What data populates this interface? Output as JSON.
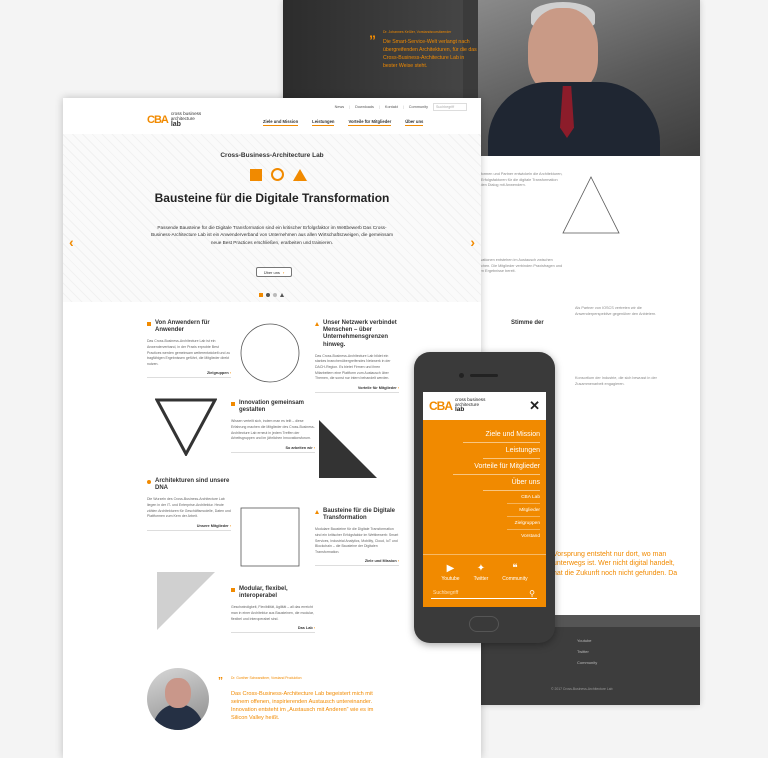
{
  "back": {
    "quote_author": "Dr. Johannes Keßler, Vorstandsvorsitzender",
    "quote_text": "Die Smart-Service-Welt verlangt nach übergreifenden Architekturen, für die das Cross-Business-Architecture Lab in bester Weise steht.",
    "body1": "Plattformen und Partner entwickeln die Architekturen, sind Erfolgsfaktoren für die digitale Transformation und den Dialog mit Anwendern.",
    "body2": "Innovationen entstehen im Austausch zwischen Branchen. Die Mitglieder verbinden Praxisfragen und stellen Ergebnisse bereit.",
    "stimme": "Stimme der",
    "body3": "Als Partner von IOSCS vertreten wir die Anwenderperspektive gegenüber den Anbietern.",
    "body4": "Konsortium der Industrie, die sich bewusst in der Zusammenarbeit engagieren.",
    "orange_text": "Vorsprung entsteht nur dort, wo man unterwegs ist. Wer nicht digital handelt, hat die Zukunft noch nicht gefunden. Da",
    "footer_social": [
      "Youtube",
      "Twitter",
      "Community"
    ],
    "copyright": "© 2017 Cross-Business-Architecture Lab"
  },
  "topbar": {
    "links": [
      "News",
      "Downloads",
      "Kontakt",
      "Community"
    ],
    "search_placeholder": "Suchbegriff"
  },
  "logo": {
    "mark": "CBA",
    "line1": "cross business",
    "line2": "architecture",
    "line3": "lab"
  },
  "nav": [
    "Ziele und Mission",
    "Leistungen",
    "Vorteile für Mitglieder",
    "Über uns"
  ],
  "hero": {
    "kicker": "Cross-Business-Architecture Lab",
    "title": "Bausteine für die Digitale Transformation",
    "text": "Passende Bausteine für die Digitale Transformation sind ein kritischer Erfolgsfaktor im Wettbewerb Das Cross-Business-Architecture Lab ist ein Anwenderverband von Unternehmen aus allen Wirtschaftszweigen, die gemeinsam neue Best Practices erschließen, erarbeiten und trainieren.",
    "button": "Über uns",
    "prev": "‹",
    "next": "›"
  },
  "features": [
    {
      "title": "Von Anwendern für Anwender",
      "text": "Das Cross-Business-Architecture Lab ist ein Anwenderverband, in der Praxis erprobte Best Practices werden gemeinsam weiterentwickelt und zu tragfähigen Ergebnissen geführt, die Mitglieder direkt nutzen.",
      "more": "Zielgruppen"
    },
    {
      "title": "Unser Netzwerk verbindet Menschen – über Unternehmensgrenzen hinweg.",
      "text": "Das Cross-Business-Architecture Lab bildet ein starkes branchenübergreifendes Netzwerk in der DACH-Region. Es bietet Firmen und ihren Mitarbeitern eine Plattform zum Austausch über Themen, die sonst nur intern behandelt werden.",
      "more": "Vorteile für Mitglieder"
    },
    {
      "title": "Innovation gemeinsam gestalten",
      "text": "Wissen verteilt sich, indem man es teilt – diese Erfahrung machen die Mitglieder des Cross-Business-Architecture Lab erneut in jedem Treffen der Arbeitsgruppen und im jährlichen Innovationsforum.",
      "more": "So arbeiten wir"
    },
    {
      "title": "Architekturen sind unsere DNA",
      "text": "Die Wurzeln des Cross-Business-Architecture Lab liegen in der IT- und Enterprise-Architektur. Heute zählen Architekturen für Geschäftsmodelle, Daten und Plattformen zum Kern der Arbeit.",
      "more": "Unsere Mitglieder"
    },
    {
      "title": "Bausteine für die Digitale Transformation",
      "text": "Modulare Bausteine für die Digitale Transformation sind ein kritischer Erfolgsfaktor im Wettbewerb: Smart Services, Industrial Analytics, Mobility, Cloud, IoT und Blockchain – die Bausteine der Digitalen Transformation.",
      "more": "Ziele und Mission"
    },
    {
      "title": "Modular, flexibel, interoperabel",
      "text": "Geschwindigkeit, Flexibilität, Agilität – all das erreicht man in einer Architektur aus Bausteinen, die modular, flexibel und interoperabel sind.",
      "more": "Das Lab"
    }
  ],
  "quote": {
    "author": "Dr. Gunther Schwandtner, Vorstand Produktion",
    "text": "Das Cross-Business-Architecture Lab begeistert mich mit seinem offenen, inspirierenden Austausch untereinander. Innovation entsteht im „Austausch mit Anderen“ wie es im Silicon Valley heißt."
  },
  "mobile": {
    "logo_mark": "CBA",
    "logo_line1": "cross business",
    "logo_line2": "architecture",
    "logo_line3": "lab",
    "close": "✕",
    "nav_main": [
      "Ziele und Mission",
      "Leistungen",
      "Vorteile für Mitglieder",
      "Über uns"
    ],
    "nav_sub": [
      "CBA Lab",
      "Mitglieder",
      "Zielgruppen",
      "Vorstand"
    ],
    "social": [
      "Youtube",
      "Twitter",
      "Community"
    ],
    "search_placeholder": "Suchbegriff"
  },
  "colors": {
    "accent": "#f18a00",
    "dark": "#3a3a3a"
  }
}
